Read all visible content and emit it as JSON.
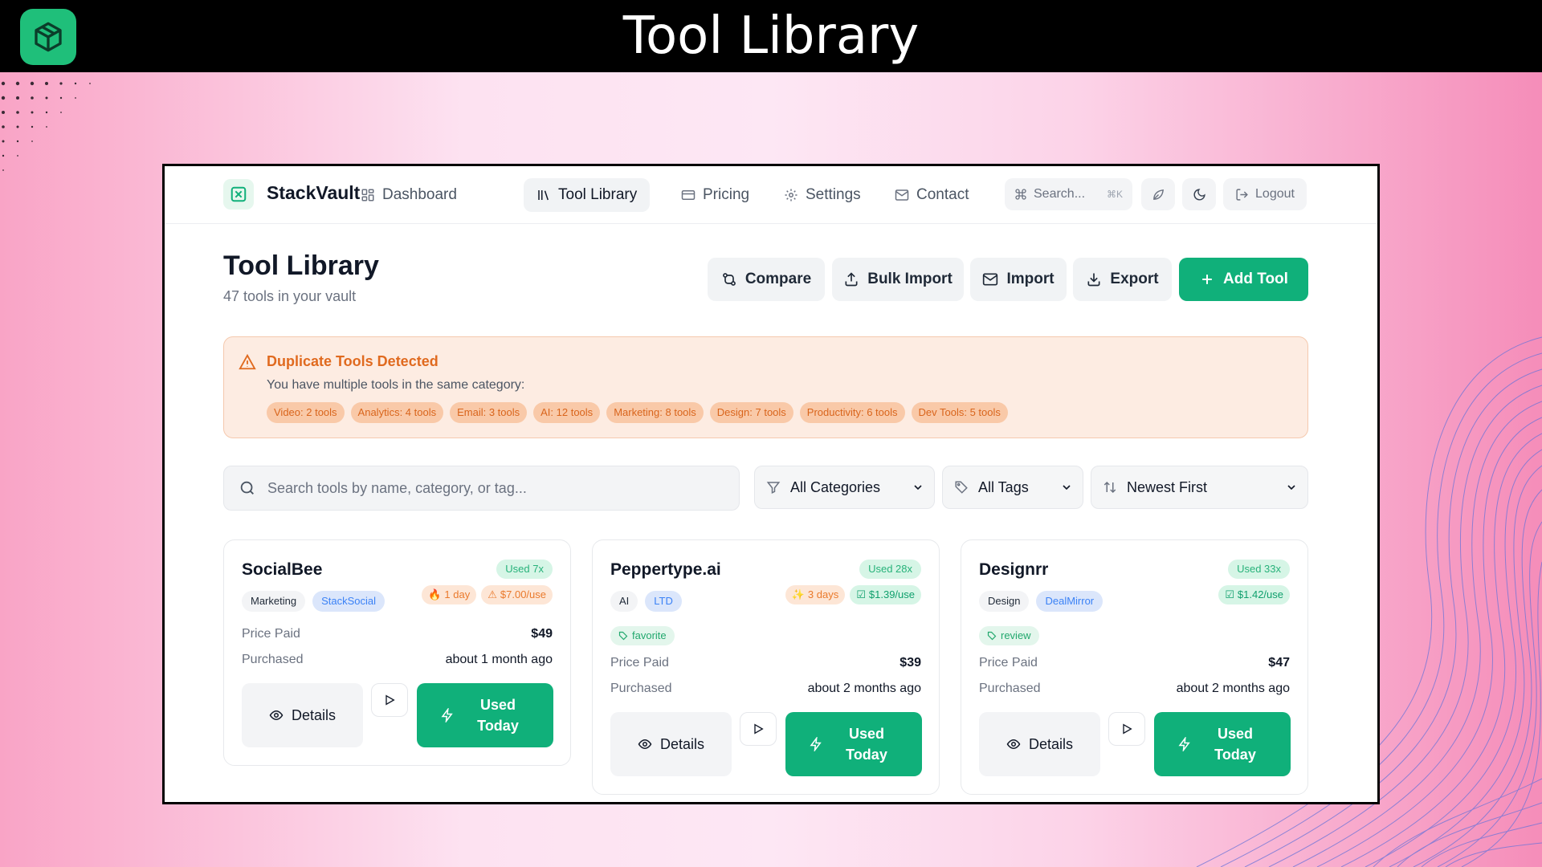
{
  "banner": {
    "title": "Tool Library"
  },
  "app": {
    "brand": "StackVault"
  },
  "nav": {
    "items": [
      {
        "label": "Dashboard",
        "icon": "grid-icon"
      },
      {
        "label": "Tool Library",
        "icon": "library-icon"
      },
      {
        "label": "Pricing",
        "icon": "card-icon"
      },
      {
        "label": "Settings",
        "icon": "gear-icon"
      },
      {
        "label": "Contact",
        "icon": "mail-icon"
      }
    ],
    "active": "Tool Library",
    "search_label": "Search...",
    "search_shortcut": "⌘K",
    "logout": "Logout"
  },
  "header": {
    "title": "Tool Library",
    "subtitle": "47 tools in your vault",
    "actions": {
      "compare": "Compare",
      "bulk_import": "Bulk Import",
      "import": "Import",
      "export": "Export",
      "add_tool": "Add Tool"
    }
  },
  "alert": {
    "title": "Duplicate Tools Detected",
    "text": "You have multiple tools in the same category:",
    "chips": [
      "Video: 2 tools",
      "Analytics: 4 tools",
      "Email: 3 tools",
      "AI: 12 tools",
      "Marketing: 8 tools",
      "Design: 7 tools",
      "Productivity: 6 tools",
      "Dev Tools: 5 tools"
    ]
  },
  "filters": {
    "search_placeholder": "Search tools by name, category, or tag...",
    "category": "All Categories",
    "tags": "All Tags",
    "sort": "Newest First"
  },
  "cards": [
    {
      "name": "SocialBee",
      "used": "Used 7x",
      "category": "Marketing",
      "source": "StackSocial",
      "age": "1 day",
      "cost": "$7.00/use",
      "cost_status": "warn",
      "label": "",
      "price_label": "Price Paid",
      "price": "$49",
      "purchased_label": "Purchased",
      "purchased": "about 1 month ago",
      "details": "Details",
      "used_today_1": "Used",
      "used_today_2": "Today"
    },
    {
      "name": "Peppertype.ai",
      "used": "Used 28x",
      "category": "AI",
      "source": "LTD",
      "age": "3 days",
      "cost": "$1.39/use",
      "cost_status": "good",
      "label": "favorite",
      "price_label": "Price Paid",
      "price": "$39",
      "purchased_label": "Purchased",
      "purchased": "about 2 months ago",
      "details": "Details",
      "used_today_1": "Used",
      "used_today_2": "Today"
    },
    {
      "name": "Designrr",
      "used": "Used 33x",
      "category": "Design",
      "source": "DealMirror",
      "age": "",
      "cost": "$1.42/use",
      "cost_status": "good",
      "label": "review",
      "price_label": "Price Paid",
      "price": "$47",
      "purchased_label": "Purchased",
      "purchased": "about 2 months ago",
      "details": "Details",
      "used_today_1": "Used",
      "used_today_2": "Today"
    }
  ],
  "colors": {
    "accent": "#10b07a",
    "warning": "#e06a1f",
    "link_blue": "#3b82f6"
  }
}
